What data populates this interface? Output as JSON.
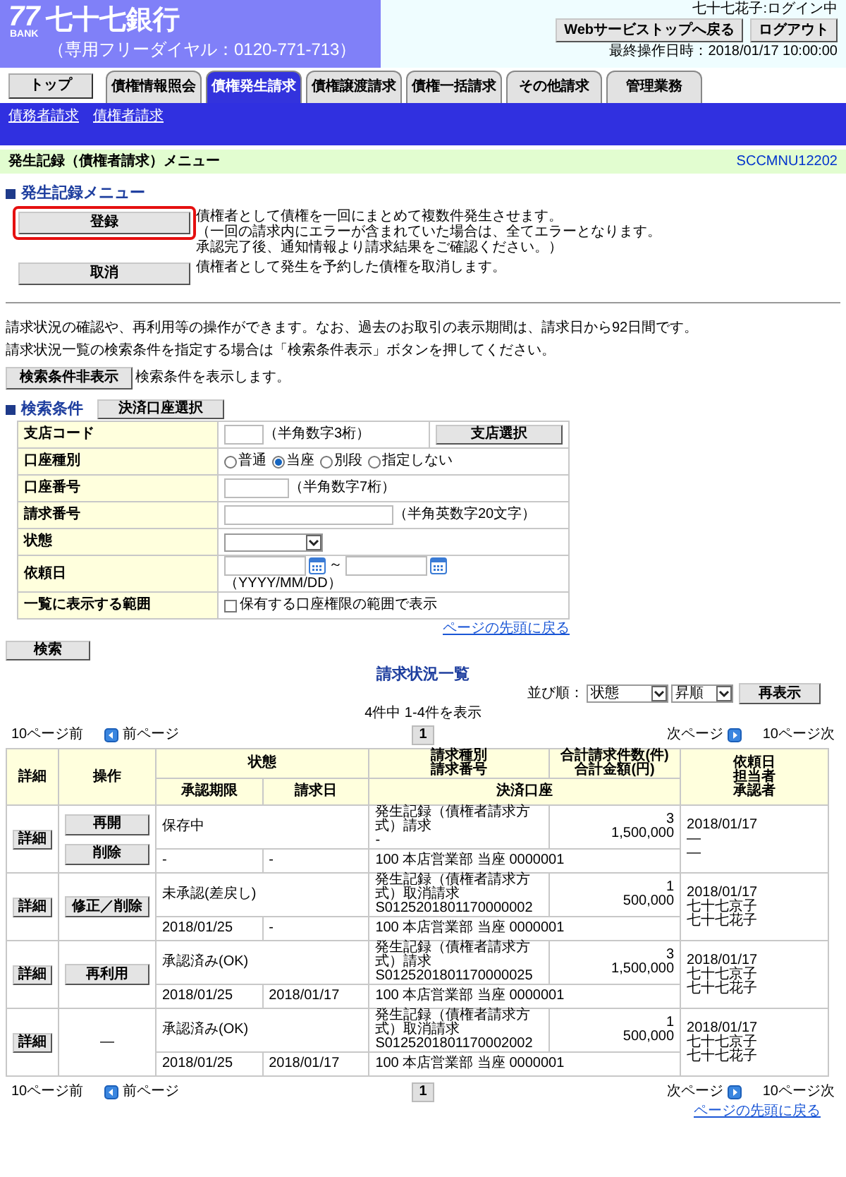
{
  "header": {
    "logo_number": "77",
    "logo_text": "BANK",
    "bank_name": "七十七銀行",
    "phone": "（専用フリーダイヤル：0120-771-713）",
    "user_status": "七十七花子:ログイン中",
    "buttons": [
      "Webサービストップへ戻る",
      "ログアウト"
    ],
    "last_operation": "最終操作日時：2018/01/17 10:00:00"
  },
  "tabs": [
    {
      "label": "トップ",
      "kind": "home",
      "selected": false
    },
    {
      "label": "債権情報照会",
      "kind": "tab",
      "selected": false
    },
    {
      "label": "債権発生請求",
      "kind": "tab",
      "selected": true
    },
    {
      "label": "債権譲渡請求",
      "kind": "tab",
      "selected": false
    },
    {
      "label": "債権一括請求",
      "kind": "tab",
      "selected": false
    },
    {
      "label": "その他請求",
      "kind": "tab",
      "selected": false
    },
    {
      "label": "管理業務",
      "kind": "tab",
      "selected": false
    }
  ],
  "sub_nav": [
    "債務者請求",
    "債権者請求"
  ],
  "page_title": "発生記録（債権者請求）メニュー",
  "screen_id": "SCCMNU12202",
  "menu": {
    "heading": "発生記録メニュー",
    "items": [
      {
        "button": "登録",
        "highlighted": true,
        "description": [
          "債権者として債権を一回にまとめて複数件発生させます。",
          "（一回の請求内にエラーが含まれていた場合は、全てエラーとなります。",
          "承認完了後、通知情報より請求結果をご確認ください。）"
        ]
      },
      {
        "button": "取消",
        "highlighted": false,
        "description": [
          "債権者として発生を予約した債権を取消します。"
        ]
      }
    ]
  },
  "notes": [
    "請求状況の確認や、再利用等の操作ができます。なお、過去のお取引の表示期間は、請求日から92日間です。",
    "請求状況一覧の検索条件を指定する場合は「検索条件表示」ボタンを押してください。"
  ],
  "toggle": {
    "button": "検索条件非表示",
    "note": "検索条件を表示します。"
  },
  "search": {
    "heading": "検索条件",
    "account_button": "決済口座選択",
    "rows": [
      {
        "label": "支店コード",
        "kind": "branch",
        "hint": "（半角数字3桁）",
        "button": "支店選択"
      },
      {
        "label": "口座種別",
        "kind": "radio",
        "options": [
          {
            "label": "普通",
            "selected": false
          },
          {
            "label": "当座",
            "selected": true
          },
          {
            "label": "別段",
            "selected": false
          },
          {
            "label": "指定しない",
            "selected": false
          }
        ]
      },
      {
        "label": "口座番号",
        "kind": "account",
        "hint": "（半角数字7桁）"
      },
      {
        "label": "請求番号",
        "kind": "request",
        "hint": "（半角英数字20文字）"
      },
      {
        "label": "状態",
        "kind": "select"
      },
      {
        "label": "依頼日",
        "kind": "date_range",
        "separator": "～",
        "hint": "（YYYY/MM/DD）"
      },
      {
        "label": "一覧に表示する範囲",
        "kind": "checkbox",
        "text": "保有する口座権限の範囲で表示",
        "checked": false
      }
    ],
    "top_link": "ページの先頭に戻る",
    "search_button": "検索"
  },
  "results": {
    "title": "請求状況一覧",
    "sort_label": "並び順：",
    "sort_value": "状態",
    "order_value": "昇順",
    "redisplay_button": "再表示",
    "count": "4件中 1-4件を表示",
    "pager_top": {
      "prev10": "10ページ前",
      "prev": "前ページ",
      "page": "1",
      "next": "次ページ",
      "next10": "10ページ次"
    },
    "headers": {
      "detail": "詳細",
      "operation": "操作",
      "status": "状態",
      "type": [
        "請求種別",
        "請求番号"
      ],
      "totals": [
        "合計請求件数(件)",
        "合計金額(円)"
      ],
      "requested": [
        "依頼日",
        "担当者",
        "承認者"
      ],
      "deadline": "承認期限",
      "request_date": "請求日",
      "account": "決済口座"
    },
    "rows": [
      {
        "detail_button": "詳細",
        "actions": [
          "再開",
          "削除"
        ],
        "status": "保存中",
        "request_type": "発生記録（債権者請求方式）請求",
        "request_number": "-",
        "count": "3",
        "amount": "1,500,000",
        "deadline": "-",
        "request_date": "-",
        "account": "100 本店営業部 当座 0000001",
        "requested_on": "2018/01/17",
        "assignee": "—",
        "approver": "—"
      },
      {
        "detail_button": "詳細",
        "actions": [
          "修正／削除"
        ],
        "status": "未承認(差戻し)",
        "request_type": "発生記録（債権者請求方式）取消請求",
        "request_number": "S0125201801170000002",
        "count": "1",
        "amount": "500,000",
        "deadline": "2018/01/25",
        "request_date": "-",
        "account": "100 本店営業部 当座 0000001",
        "requested_on": "2018/01/17",
        "assignee": "七十七京子",
        "approver": "七十七花子"
      },
      {
        "detail_button": "詳細",
        "actions": [
          "再利用"
        ],
        "status": "承認済み(OK)",
        "request_type": "発生記録（債権者請求方式）請求",
        "request_number": "S0125201801170000025",
        "count": "3",
        "amount": "1,500,000",
        "deadline": "2018/01/25",
        "request_date": "2018/01/17",
        "account": "100 本店営業部 当座 0000001",
        "requested_on": "2018/01/17",
        "assignee": "七十七京子",
        "approver": "七十七花子"
      },
      {
        "detail_button": "詳細",
        "no_action": "—",
        "status": "承認済み(OK)",
        "request_type": "発生記録（債権者請求方式）取消請求",
        "request_number": "S0125201801170002002",
        "count": "1",
        "amount": "500,000",
        "deadline": "2018/01/25",
        "request_date": "2018/01/17",
        "account": "100 本店営業部 当座 0000001",
        "requested_on": "2018/01/17",
        "assignee": "七十七京子",
        "approver": "七十七花子"
      }
    ],
    "pager_bottom": {
      "prev10": "10ページ前",
      "prev": "前ページ",
      "page": "1",
      "next": "次ページ",
      "next10": "10ページ次"
    },
    "top_link": "ページの先頭に戻る"
  }
}
